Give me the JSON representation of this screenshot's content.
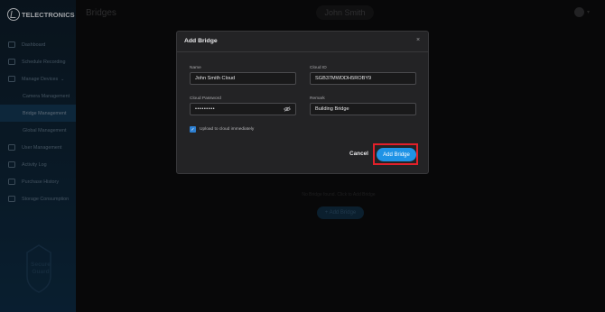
{
  "app": {
    "logo_text": "TELECTRONICS",
    "page_title": "Bridges",
    "user_name": "John Smith",
    "shield_text": "Secure Guard"
  },
  "sidebar": {
    "items": [
      {
        "label": "Dashboard",
        "icon": "grid-icon"
      },
      {
        "label": "Schedule Recording",
        "icon": "calendar-icon"
      },
      {
        "label": "Manage Devices",
        "icon": "devices-icon"
      },
      {
        "label": "Camera Management",
        "icon": ""
      },
      {
        "label": "Bridge Management",
        "icon": ""
      },
      {
        "label": "Global Management",
        "icon": ""
      },
      {
        "label": "User Management",
        "icon": "user-icon"
      },
      {
        "label": "Activity Log",
        "icon": "log-icon"
      },
      {
        "label": "Purchase History",
        "icon": "history-icon"
      },
      {
        "label": "Storage Consumption",
        "icon": "storage-icon"
      }
    ]
  },
  "background": {
    "empty_text": "No Bridge found. Click to Add Bridge",
    "add_label": "+ Add Bridge"
  },
  "modal": {
    "title": "Add Bridge",
    "close": "×",
    "fields": {
      "name_label": "Name",
      "name_value": "John Smith Cloud",
      "cloud_id_label": "Cloud ID",
      "cloud_id_value": "SGB37MWDDH5ROBY9",
      "password_label": "Cloud Password",
      "password_value": "•••••••••",
      "remark_label": "Remark",
      "remark_value": "Building Bridge"
    },
    "checkbox_label": "Upload to cloud immediately",
    "checkbox_checked": true,
    "cancel_label": "Cancel",
    "submit_label": "Add Bridge"
  },
  "colors": {
    "accent": "#1e93e6",
    "highlight": "#e2202a",
    "modal_bg": "#232325"
  }
}
